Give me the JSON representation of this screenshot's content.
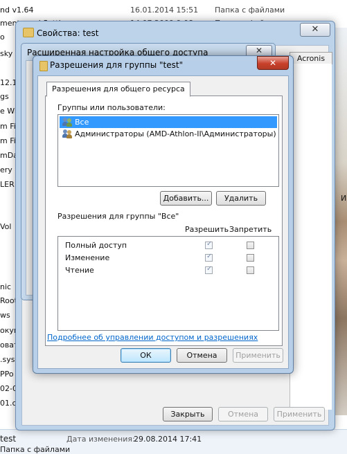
{
  "background": {
    "rows": [
      {
        "name": "nd v1.64",
        "date": "16.01.2014 15:51",
        "type": "Папка с файлами"
      },
      {
        "name": "ments and Settings",
        "date": "14.07.2009 9:08",
        "type": "Папка с файлами"
      }
    ],
    "left_names": [
      "o",
      "sky F",
      "",
      "12.16",
      "gs",
      "e Wi",
      "m Fi",
      "m Fi",
      "mDa",
      "ery",
      "LER",
      "",
      "Vol",
      "",
      "",
      "nic",
      "Root",
      "ws",
      "окум",
      "оват",
      ".sys",
      "PPo",
      "02-0",
      "01.c"
    ],
    "right_label": "И",
    "status": {
      "left_name": "test",
      "left_sub": "Папка с файлами",
      "date_label": "Дата изменения:",
      "date_value": "29.08.2014 17:41"
    }
  },
  "props_window": {
    "title": "Свойства: test",
    "close": "✕",
    "acronis_tab": "Acronis",
    "buttons": {
      "close": "Закрыть",
      "cancel": "Отмена",
      "apply": "Применить"
    }
  },
  "adv_window": {
    "title": "Расширенная настройка общего доступа",
    "close": "✕"
  },
  "perm_window": {
    "title": "Разрешения для группы \"test\"",
    "close": "✕",
    "tab": "Разрешения для общего ресурса",
    "groups_label": "Группы или пользователи:",
    "groups": [
      {
        "name": "Все",
        "selected": true
      },
      {
        "name": "Администраторы (AMD-Athlon-II\\Администраторы)",
        "selected": false
      }
    ],
    "add_button": "Добавить...",
    "remove_button": "Удалить",
    "perms_label": "Разрешения для группы \"Все\"",
    "allow_header": "Разрешить",
    "deny_header": "Запретить",
    "permissions": [
      {
        "name": "Полный доступ",
        "allow": true,
        "deny": false
      },
      {
        "name": "Изменение",
        "allow": true,
        "deny": false
      },
      {
        "name": "Чтение",
        "allow": true,
        "deny": false
      }
    ],
    "help_link": "Подробнее об управлении доступом и разрешениях",
    "ok": "ОК",
    "cancel": "Отмена",
    "apply": "Применить"
  }
}
